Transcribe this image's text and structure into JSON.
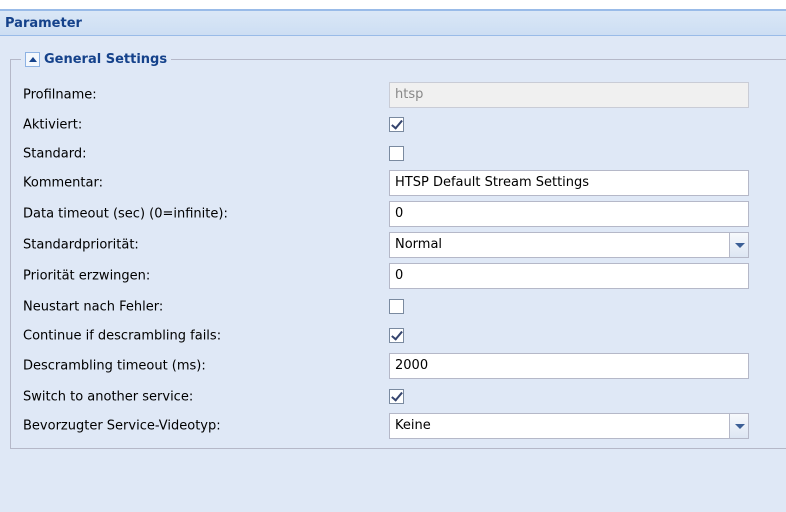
{
  "panel": {
    "title": "Parameter"
  },
  "section": {
    "title": "General Settings"
  },
  "fields": [
    {
      "label": "Profilname:",
      "type": "text",
      "value": "htsp",
      "disabled": true
    },
    {
      "label": "Aktiviert:",
      "type": "checkbox",
      "checked": true
    },
    {
      "label": "Standard:",
      "type": "checkbox",
      "checked": false
    },
    {
      "label": "Kommentar:",
      "type": "text",
      "value": "HTSP Default Stream Settings"
    },
    {
      "label": "Data timeout (sec) (0=infinite):",
      "type": "text",
      "value": "0"
    },
    {
      "label": "Standardpriorität:",
      "type": "select",
      "value": "Normal"
    },
    {
      "label": "Priorität erzwingen:",
      "type": "text",
      "value": "0"
    },
    {
      "label": "Neustart nach Fehler:",
      "type": "checkbox",
      "checked": false
    },
    {
      "label": "Continue if descrambling fails:",
      "type": "checkbox",
      "checked": true
    },
    {
      "label": "Descrambling timeout (ms):",
      "type": "text",
      "value": "2000"
    },
    {
      "label": "Switch to another service:",
      "type": "checkbox",
      "checked": true
    },
    {
      "label": "Bevorzugter Service-Videotyp:",
      "type": "select",
      "value": "Keine"
    }
  ]
}
